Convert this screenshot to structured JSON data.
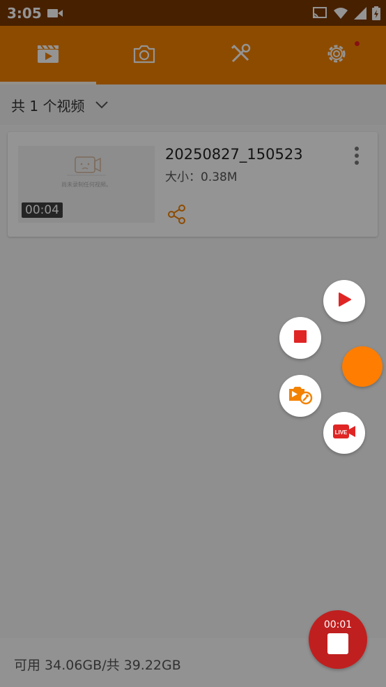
{
  "status_bar": {
    "time": "3:05"
  },
  "tabs": [
    {
      "id": "videos",
      "icon": "video-clapper-icon",
      "active": true
    },
    {
      "id": "screenshots",
      "icon": "camera-icon",
      "active": false
    },
    {
      "id": "tools",
      "icon": "tools-icon",
      "active": false
    },
    {
      "id": "settings",
      "icon": "gear-icon",
      "active": false,
      "badge": true
    }
  ],
  "filter": {
    "label": "共 1 个视频"
  },
  "videos": [
    {
      "thumbnail_hint": "尚未录制任何视频。",
      "duration": "00:04",
      "title": "20250827_150523",
      "size": "大小：0.38M"
    }
  ],
  "footer": {
    "storage": "可用 34.06GB/共 39.22GB"
  },
  "recorder": {
    "elapsed": "00:01"
  },
  "colors": {
    "accent": "#f38200",
    "status_bar": "#7a3700",
    "record_red": "#e02525"
  }
}
